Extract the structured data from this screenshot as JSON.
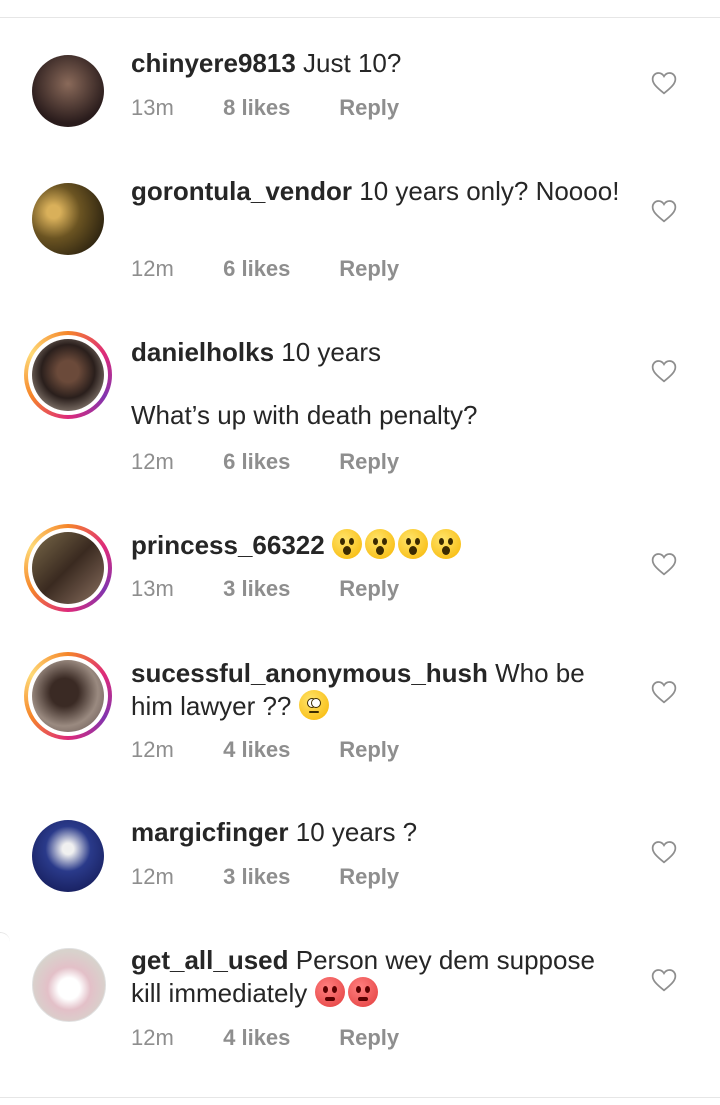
{
  "comments": [
    {
      "username": "chinyere9813",
      "text": "Just 10?",
      "text2": "",
      "time": "13m",
      "likes": "8 likes",
      "reply": "Reply",
      "avatar_color": "#3a2a2a",
      "ring": false,
      "emoji": []
    },
    {
      "username": "gorontula_vendor",
      "text": "10 years only? Noooo!",
      "text2": "",
      "time": "12m",
      "likes": "6 likes",
      "reply": "Reply",
      "avatar_color": "#6b5422",
      "ring": false,
      "emoji": []
    },
    {
      "username": "danielholks",
      "text": "10 years",
      "text2": "What’s up with death penalty?",
      "time": "12m",
      "likes": "6 likes",
      "reply": "Reply",
      "avatar_color": "#2f2a28",
      "ring": true,
      "emoji": []
    },
    {
      "username": "princess_66322",
      "text": "",
      "text2": "",
      "time": "13m",
      "likes": "3 likes",
      "reply": "Reply",
      "avatar_color": "#4a3a30",
      "ring": true,
      "emoji": [
        "wow",
        "wow",
        "wow",
        "wow"
      ]
    },
    {
      "username": "sucessful_anonymous_hush",
      "text": "Who be him lawyer ??",
      "text2": "",
      "time": "12m",
      "likes": "4 likes",
      "reply": "Reply",
      "avatar_color": "#5b4c45",
      "ring": true,
      "emoji": [
        "flushed"
      ]
    },
    {
      "username": "margicfinger",
      "text": "10 years ?",
      "text2": "",
      "time": "12m",
      "likes": "3 likes",
      "reply": "Reply",
      "avatar_color": "#23306e",
      "ring": false,
      "emoji": []
    },
    {
      "username": "get_all_used",
      "text": "Person wey dem suppose kill immediately",
      "text2": "",
      "time": "12m",
      "likes": "4 likes",
      "reply": "Reply",
      "avatar_color": "#e6e0dc",
      "ring": false,
      "emoji": [
        "angry",
        "angry"
      ]
    }
  ],
  "colors": {
    "ring_start": "#f58529",
    "ring_end": "#dd2a7b",
    "meta": "#8e8e8e"
  },
  "icons": {
    "like": "heart-outline-icon"
  }
}
